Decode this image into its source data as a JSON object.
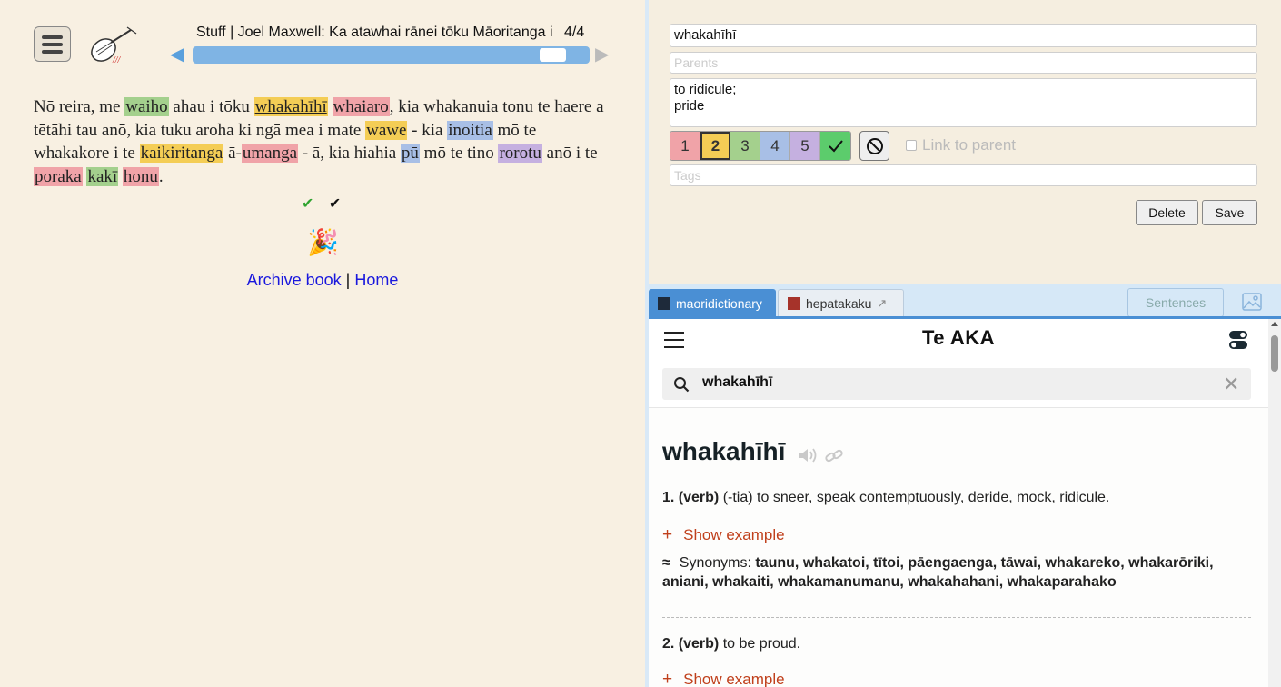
{
  "reader": {
    "book_title": "Stuff | Joel Maxwell: Ka atawhai rānei tōku Māoritanga i",
    "page": "4/4",
    "progress_percent": 94,
    "checks": {
      "green": "✔",
      "black": "✔"
    },
    "party": "🎉",
    "footer": {
      "archive": "Archive book",
      "separator": " | ",
      "home": "Home"
    },
    "passage": [
      {
        "t": "Nō reira, me "
      },
      {
        "w": "waiho",
        "c": "g"
      },
      {
        "t": " ahau i tōku "
      },
      {
        "w": "whakahīhī",
        "c": "y",
        "sel": true
      },
      {
        "t": " "
      },
      {
        "w": "whaiaro",
        "c": "r"
      },
      {
        "t": ", kia whakanuia tonu te haere a tētāhi tau anō, kia tuku aroha ki ngā mea i mate "
      },
      {
        "w": "wawe",
        "c": "y"
      },
      {
        "t": " - kia "
      },
      {
        "w": "inoitia",
        "c": "b"
      },
      {
        "t": " mō te whakakore i te "
      },
      {
        "w": "kaikiritanga",
        "c": "y"
      },
      {
        "t": " ā-"
      },
      {
        "w": "umanga",
        "c": "r"
      },
      {
        "t": " - ā, kia hiahia "
      },
      {
        "w": "pū",
        "c": "b"
      },
      {
        "t": " mō te tino "
      },
      {
        "w": "rorotu",
        "c": "p"
      },
      {
        "t": " anō i te "
      },
      {
        "w": "poraka",
        "c": "r"
      },
      {
        "t": " "
      },
      {
        "w": "kakī",
        "c": "g"
      },
      {
        "t": " "
      },
      {
        "w": "honu",
        "c": "r"
      },
      {
        "t": "."
      }
    ]
  },
  "editor": {
    "word": "whakahīhī",
    "parents_placeholder": "Parents",
    "definition": "to ridicule;\npride",
    "levels": [
      "1",
      "2",
      "3",
      "4",
      "5"
    ],
    "selected_level": "2",
    "link_to_parent": "Link to parent",
    "tags_placeholder": "Tags",
    "delete_label": "Delete",
    "save_label": "Save"
  },
  "tabs": {
    "maoridictionary": "maoridictionary",
    "hepatakaku": "hepatakaku",
    "sentences": "Sentences"
  },
  "dictionary": {
    "logo": "Te AKA",
    "search_value": "whakahīhī",
    "headword": "whakahīhī",
    "sense1": {
      "num": "1. (verb)",
      "text": " (-tia) to sneer, speak contemptuously, deride, mock, ridicule."
    },
    "show_example": "Show example",
    "synonyms_label": "Synonyms: ",
    "synonyms": "taunu, whakatoi, tītoi, pāengaenga, tāwai, whakareko, whakarōriki, aniani, whakaiti, whakamanumanu, whakahahani, whakaparahako",
    "sense2": {
      "num": "2. (verb)",
      "text": " to be proud."
    }
  },
  "colors": {
    "yellow": "#f4cd55",
    "green": "#a4d08d",
    "red": "#f0a3a8",
    "blue": "#a8bfe6",
    "purple": "#c5b0e0",
    "accent": "#4a8fd4",
    "example": "#c0401c"
  }
}
